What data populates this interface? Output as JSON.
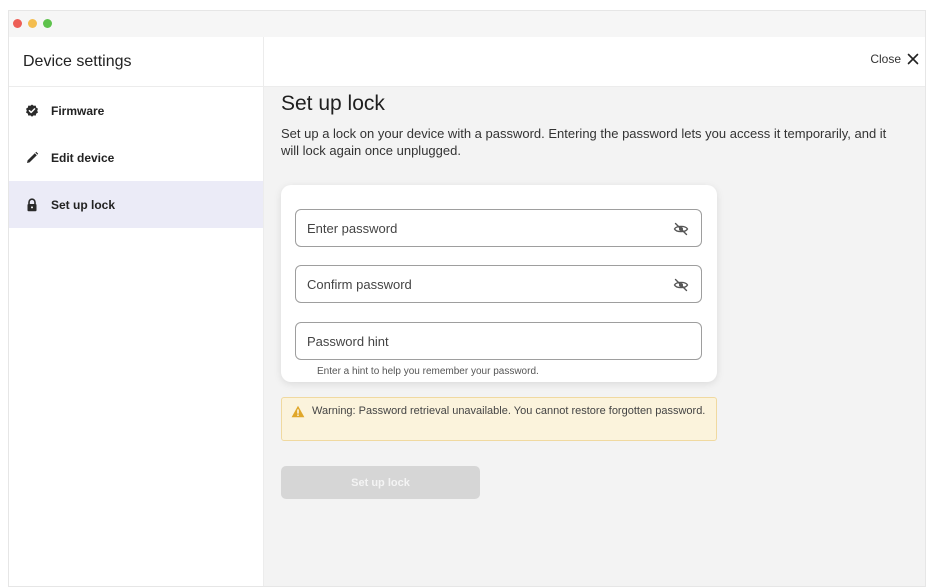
{
  "window": {
    "title": "Device settings",
    "close_label": "Close"
  },
  "sidebar": {
    "items": [
      {
        "label": "Firmware",
        "icon": "badge-check-icon",
        "active": false
      },
      {
        "label": "Edit device",
        "icon": "pencil-icon",
        "active": false
      },
      {
        "label": "Set up lock",
        "icon": "lock-icon",
        "active": true
      }
    ]
  },
  "main": {
    "title": "Set up lock",
    "description": "Set up a lock on your device with a password. Entering the password lets you access it temporarily, and it will lock again once unplugged.",
    "fields": {
      "password": {
        "placeholder": "Enter password",
        "value": ""
      },
      "confirm": {
        "placeholder": "Confirm password",
        "value": ""
      },
      "hint": {
        "placeholder": "Password hint",
        "value": "",
        "helper": "Enter a hint to help you remember your password."
      }
    },
    "warning": "Warning: Password retrieval unavailable. You cannot restore forgotten password.",
    "submit_label": "Set up lock"
  },
  "colors": {
    "active_nav": "#ebebf7",
    "warning_bg": "#fbf3dc",
    "warning_icon": "#e0a72a",
    "disabled_button": "#d6d6d6"
  }
}
